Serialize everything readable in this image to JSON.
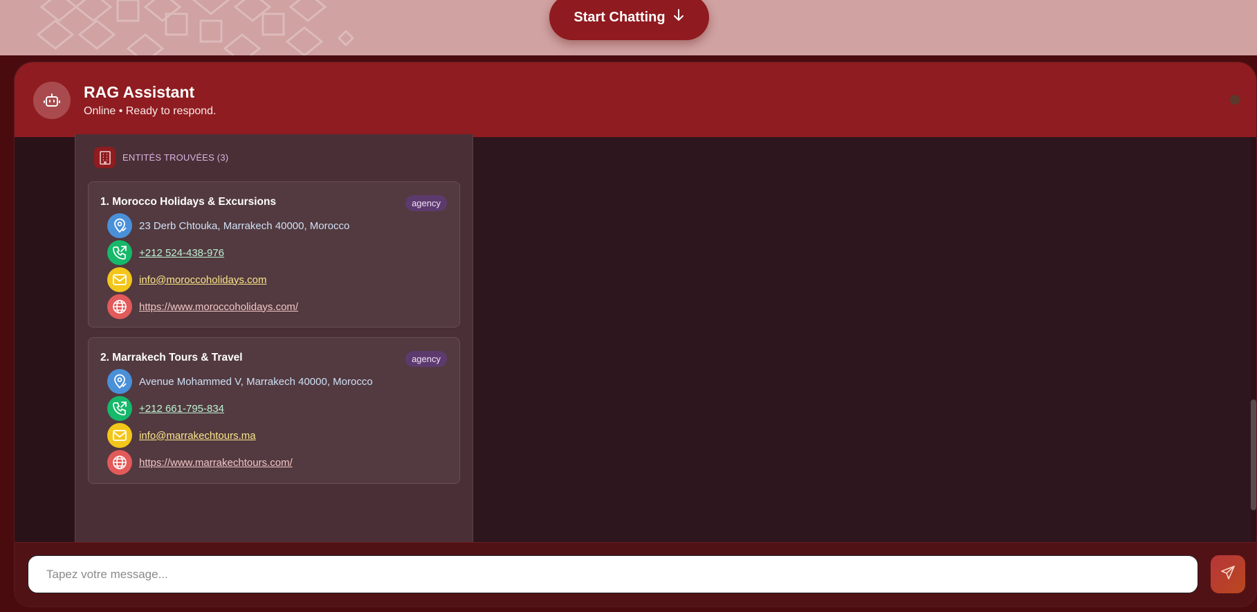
{
  "hero": {
    "start_button_label": "Start Chatting",
    "start_button_icon": "arrow-down-icon"
  },
  "chat": {
    "title": "RAG Assistant",
    "status": "Online • Ready to respond.",
    "avatar_icon": "bot-icon",
    "status_dot_color": "#5b3a2d"
  },
  "results": {
    "entities_label": "ENTITÉS TROUVÉES (3)",
    "entities_icon": "building-icon",
    "entities": [
      {
        "name": "1. Morocco Holidays & Excursions",
        "type": "agency",
        "address": "23 Derb Chtouka, Marrakech 40000, Morocco",
        "phone": "+212 524-438-976",
        "email": "info@moroccoholidays.com",
        "website": "https://www.moroccoholidays.com/"
      },
      {
        "name": "2. Marrakech Tours & Travel",
        "type": "agency",
        "address": "Avenue Mohammed V, Marrakech 40000, Morocco",
        "phone": "+212 661-795-834",
        "email": "info@marrakechtours.ma",
        "website": "https://www.marrakechtours.com/"
      }
    ]
  },
  "composer": {
    "placeholder": "Tapez votre message...",
    "send_icon": "send-icon"
  },
  "colors": {
    "primary": "#8e1c20",
    "hero_bg": "#d0a2a2",
    "panel_bg": "#2e161e",
    "location": "#4a90d9",
    "phone": "#16b86a",
    "email": "#f2c61b",
    "web": "#e25a5a",
    "badge": "#5d3a6e"
  }
}
